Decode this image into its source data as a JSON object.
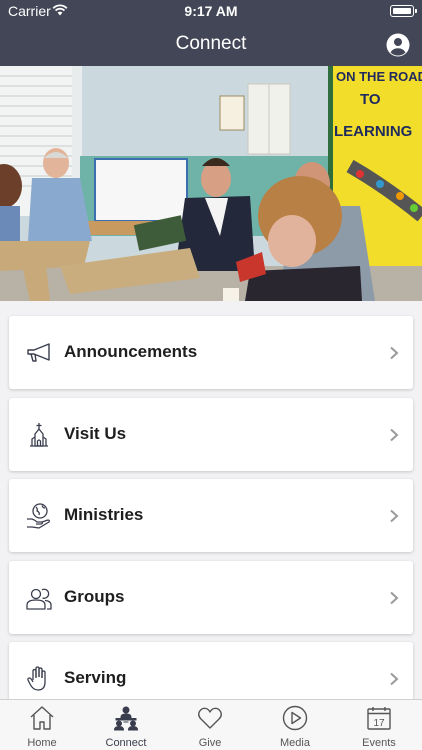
{
  "status": {
    "carrier": "Carrier",
    "time": "9:17 AM"
  },
  "header": {
    "title": "Connect"
  },
  "hero": {
    "sign_text_1": "ON THE ROAD",
    "sign_text_2": "TO",
    "sign_text_3": "LEARNING"
  },
  "menu": [
    {
      "label": "Announcements",
      "icon": "megaphone-icon"
    },
    {
      "label": "Visit Us",
      "icon": "church-icon"
    },
    {
      "label": "Ministries",
      "icon": "globe-hand-icon"
    },
    {
      "label": "Groups",
      "icon": "people-icon"
    },
    {
      "label": "Serving",
      "icon": "hand-icon"
    }
  ],
  "tabs": [
    {
      "label": "Home",
      "icon": "home-icon"
    },
    {
      "label": "Connect",
      "icon": "connect-icon",
      "active": true
    },
    {
      "label": "Give",
      "icon": "heart-icon"
    },
    {
      "label": "Media",
      "icon": "play-icon"
    },
    {
      "label": "Events",
      "icon": "calendar-icon",
      "day": "17"
    }
  ],
  "colors": {
    "header": "#434656",
    "background": "#f2f2f4",
    "card": "#ffffff",
    "icon": "#3a3d4d"
  }
}
